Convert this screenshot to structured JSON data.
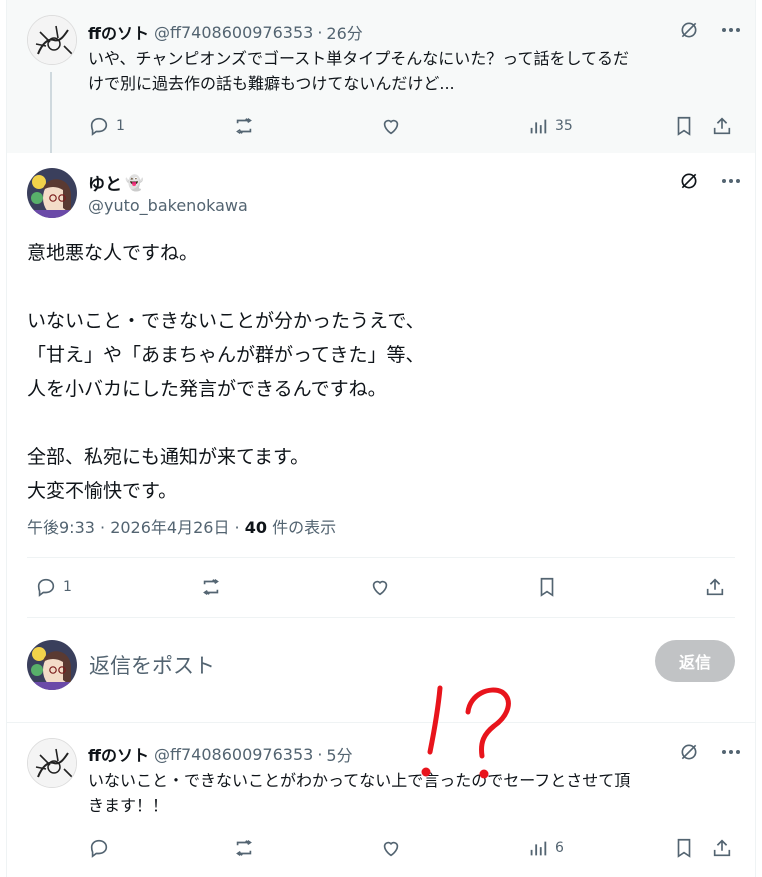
{
  "top_reply": {
    "name": "ffのソト",
    "handle": "@ff7408600976353",
    "time": "26分",
    "text_line1": "いや、チャンピオンズでゴースト単タイプそんなにいた？って話をしてるだ",
    "text_line2": "けで別に過去作の話も難癖もつけてないんだけど...",
    "reply_count": "1",
    "view_count": "35"
  },
  "main_post": {
    "name": "ゆと",
    "name_emoji": "👻",
    "handle": "@yuto_bakenokawa",
    "paragraphs": [
      [
        "意地悪な人ですね。"
      ],
      [
        "いないこと・できないことが分かったうえで、",
        "「甘え」や「あまちゃんが群がってきた」等、",
        "人を小バカにした発言ができるんですね。"
      ],
      [
        "全部、私宛にも通知が来てます。",
        "大変不愉快です。"
      ]
    ],
    "timestamp": "午後9:33 · 2026年4月26日 · ",
    "view_count": "40",
    "view_label": " 件の表示",
    "reply_count": "1"
  },
  "reply_composer": {
    "placeholder": "返信をポスト",
    "button_label": "返信"
  },
  "bottom_reply": {
    "name": "ffのソト",
    "handle": "@ff7408600976353",
    "time": "5分",
    "text_line1": "いないこと・できないことがわかってない上で言ったのでセーフとさせて頂",
    "text_line2": "きます！！",
    "view_count": "6"
  },
  "annotation": "!?",
  "colors": {
    "annotation": "#e8141c",
    "muted": "#536471",
    "text": "#0f1419"
  },
  "separator": "·"
}
